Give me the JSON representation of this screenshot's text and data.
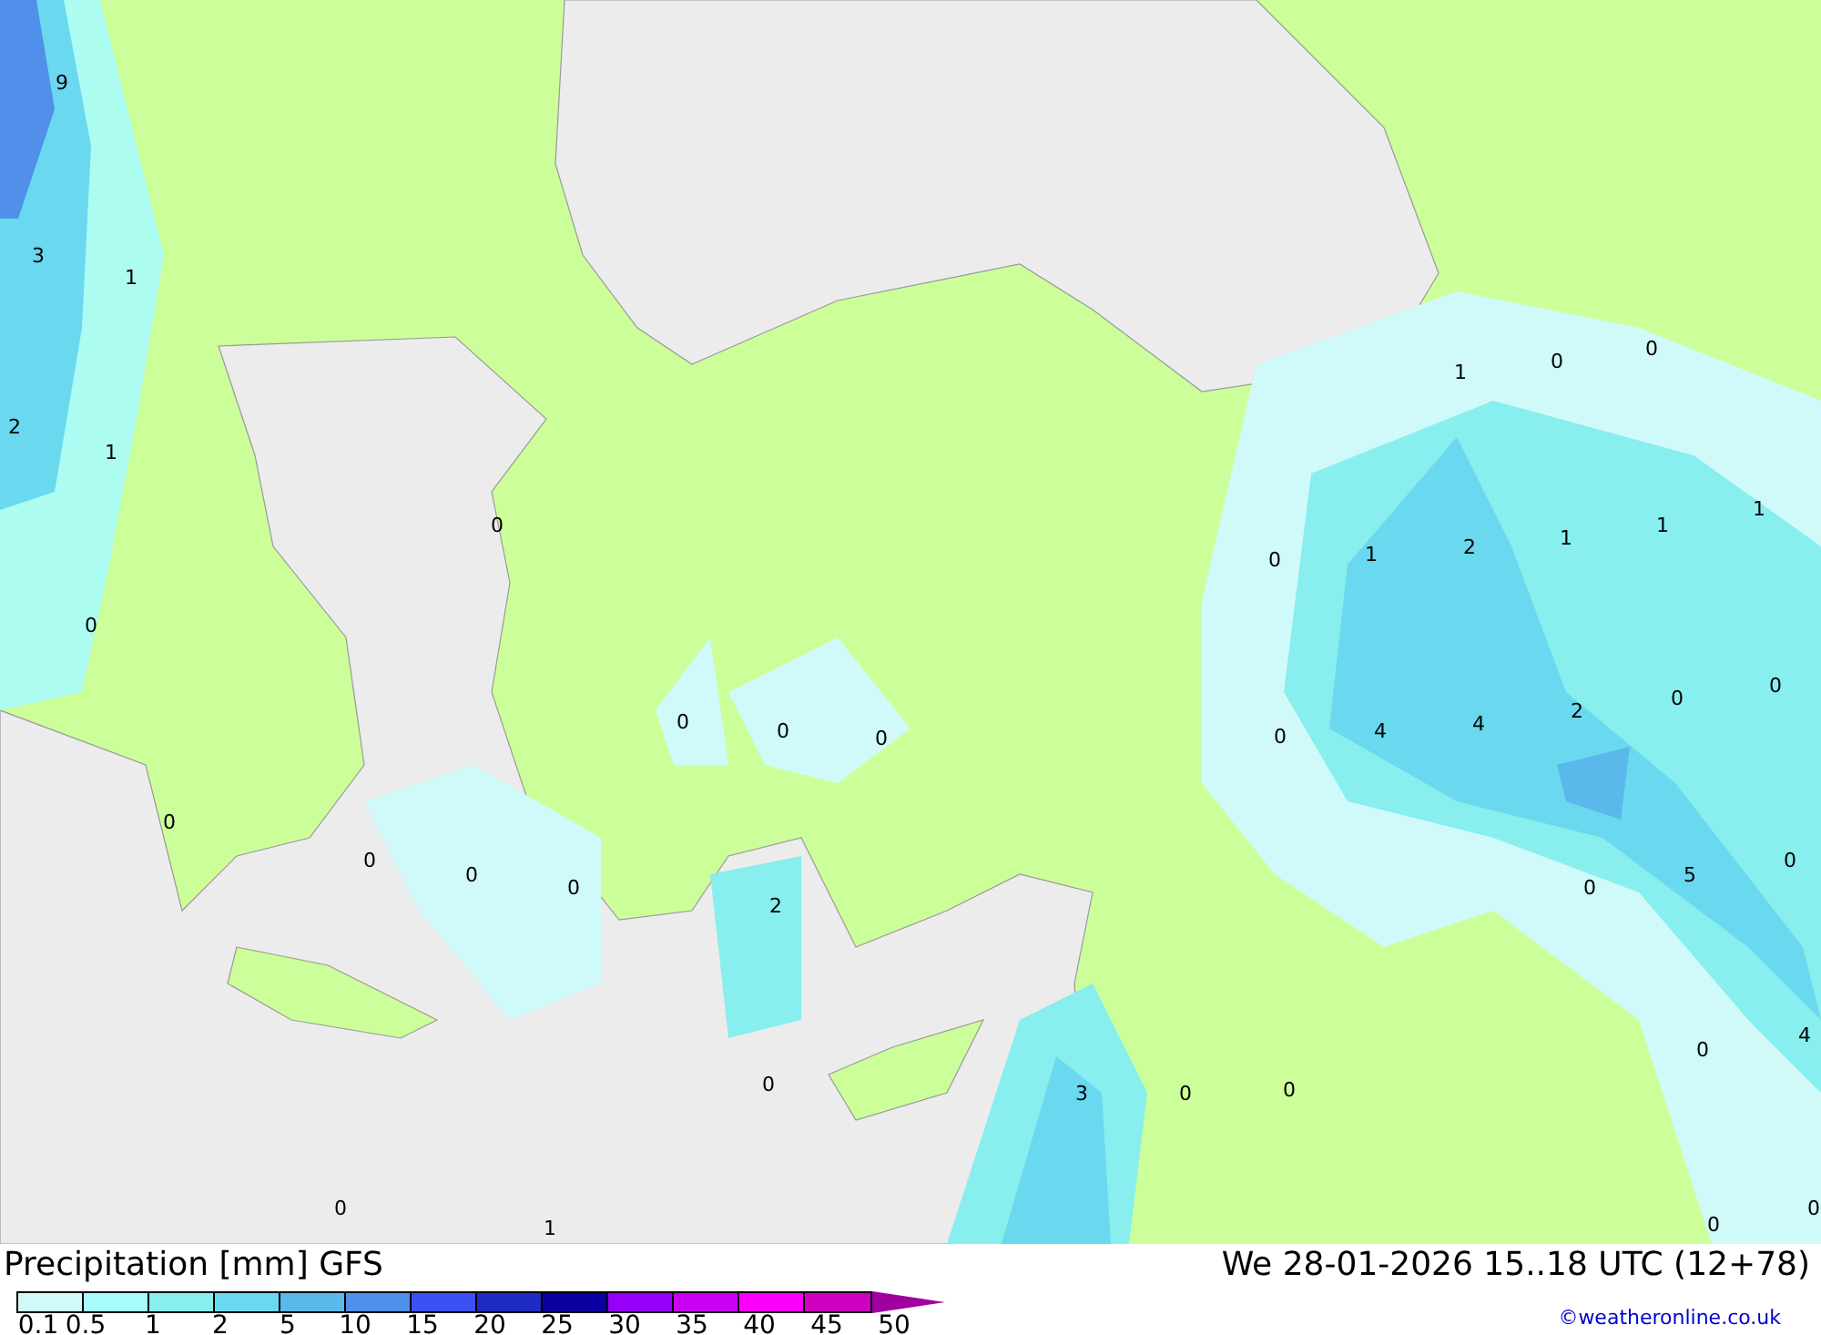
{
  "map": {
    "value_labels": [
      {
        "text": "9"
      },
      {
        "text": "3"
      },
      {
        "text": "1"
      },
      {
        "text": "2"
      },
      {
        "text": "1"
      },
      {
        "text": "0"
      },
      {
        "text": "0"
      },
      {
        "text": "0"
      },
      {
        "text": "0"
      },
      {
        "text": "0"
      },
      {
        "text": "0"
      },
      {
        "text": "0"
      },
      {
        "text": "0"
      },
      {
        "text": "0"
      },
      {
        "text": "2"
      },
      {
        "text": "0"
      },
      {
        "text": "0"
      },
      {
        "text": "1"
      },
      {
        "text": "3"
      },
      {
        "text": "0"
      },
      {
        "text": "0"
      },
      {
        "text": "1"
      },
      {
        "text": "0"
      },
      {
        "text": "0"
      },
      {
        "text": "0"
      },
      {
        "text": "1"
      },
      {
        "text": "2"
      },
      {
        "text": "1"
      },
      {
        "text": "1"
      },
      {
        "text": "1"
      },
      {
        "text": "0"
      },
      {
        "text": "4"
      },
      {
        "text": "4"
      },
      {
        "text": "2"
      },
      {
        "text": "0"
      },
      {
        "text": "0"
      },
      {
        "text": "0"
      },
      {
        "text": "5"
      },
      {
        "text": "0"
      },
      {
        "text": "0"
      },
      {
        "text": "4"
      },
      {
        "text": "0"
      },
      {
        "text": "0"
      }
    ]
  },
  "title": "Precipitation [mm] GFS",
  "valid_time": "We 28-01-2026 15..18 UTC (12+78)",
  "credit": "©weatheronline.co.uk",
  "legend": {
    "swatches": [
      {
        "color": "#d0fafa"
      },
      {
        "color": "#a8fcfc"
      },
      {
        "color": "#88eeee"
      },
      {
        "color": "#6ad8ee"
      },
      {
        "color": "#5ab8ea"
      },
      {
        "color": "#5090ea"
      },
      {
        "color": "#3c50f4"
      },
      {
        "color": "#1e2cc4"
      },
      {
        "color": "#0a00a0"
      },
      {
        "color": "#9600fa"
      },
      {
        "color": "#c800f0"
      },
      {
        "color": "#fa00fa"
      },
      {
        "color": "#d000c0"
      }
    ],
    "end_arrow": {
      "kind": "triangle"
    },
    "ticks": [
      "0.1",
      "0.5",
      "1",
      "2",
      "5",
      "10",
      "15",
      "20",
      "25",
      "30",
      "35",
      "40",
      "45",
      "50"
    ]
  }
}
